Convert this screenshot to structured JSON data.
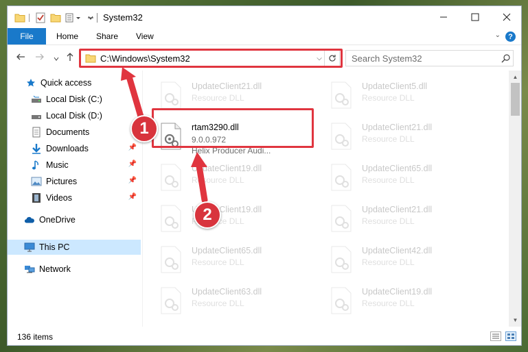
{
  "window": {
    "title": "System32"
  },
  "ribbon": {
    "tabs": [
      {
        "label": "File"
      },
      {
        "label": "Home"
      },
      {
        "label": "Share"
      },
      {
        "label": "View"
      }
    ],
    "help_label": "?"
  },
  "address": {
    "path": "C:\\Windows\\System32",
    "search_placeholder": "Search System32"
  },
  "nav": {
    "items": [
      {
        "label": "Quick access",
        "icon": "star-icon"
      },
      {
        "label": "Local Disk (C:)",
        "icon": "drive-icon"
      },
      {
        "label": "Local Disk (D:)",
        "icon": "drive-icon"
      },
      {
        "label": "Documents",
        "icon": "documents-icon"
      },
      {
        "label": "Downloads",
        "icon": "downloads-icon"
      },
      {
        "label": "Music",
        "icon": "music-icon"
      },
      {
        "label": "Pictures",
        "icon": "pictures-icon"
      },
      {
        "label": "Videos",
        "icon": "videos-icon"
      },
      {
        "label": "OneDrive",
        "icon": "cloud-icon"
      },
      {
        "label": "This PC",
        "icon": "computer-icon"
      },
      {
        "label": "Network",
        "icon": "network-icon"
      }
    ],
    "selected": "This PC"
  },
  "files": {
    "left": [
      {
        "name": "UpdateClient21.dll",
        "type": "Resource DLL"
      },
      {
        "name": "rtam3290.dll",
        "version": "9.0.0.972",
        "description": "Helix Producer Audi..."
      },
      {
        "name": "UpdateClient19.dll",
        "type": "Resource DLL"
      },
      {
        "name": "UpdateClient19.dll",
        "type": "Resource DLL"
      },
      {
        "name": "UpdateClient65.dll",
        "type": "Resource DLL"
      },
      {
        "name": "UpdateClient63.dll",
        "type": "Resource DLL"
      }
    ],
    "right": [
      {
        "name": "UpdateClient5.dll",
        "type": "Resource DLL"
      },
      {
        "name": "UpdateClient21.dll",
        "type": "Resource DLL"
      },
      {
        "name": "UpdateClient65.dll",
        "type": "Resource DLL"
      },
      {
        "name": "UpdateClient21.dll",
        "type": "Resource DLL"
      },
      {
        "name": "UpdateClient42.dll",
        "type": "Resource DLL"
      },
      {
        "name": "UpdateClient19.dll",
        "type": "Resource DLL"
      }
    ]
  },
  "status": {
    "item_count": "136 items"
  },
  "callouts": {
    "step1": "1",
    "step2": "2"
  },
  "colors": {
    "accent": "#1979ca",
    "highlight": "#e0353f",
    "selected_bg": "#cce8ff"
  }
}
